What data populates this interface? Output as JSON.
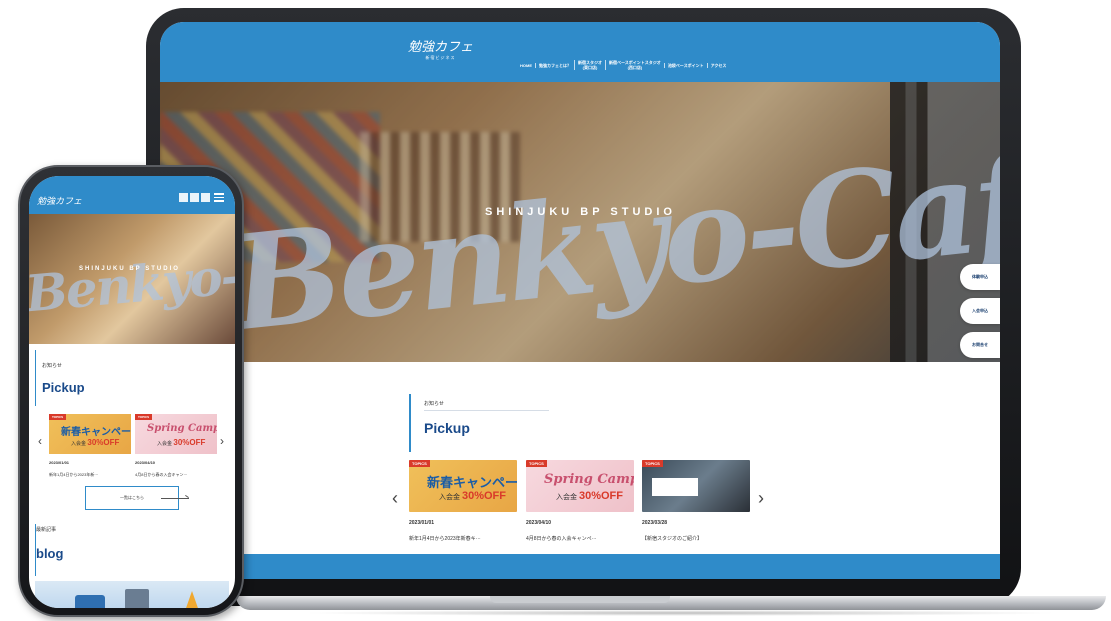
{
  "site": {
    "logo_main": "勉強カフェ",
    "logo_sub": "新宿ビジネス"
  },
  "laptop": {
    "nav": [
      "HOME",
      "勉強カフェとは？",
      "新宿スタジオ\n(東口店)",
      "新宿ベースポイントスタジオ\n(西口店)",
      "池袋ベースポイント",
      "アクセス"
    ],
    "hero": {
      "script_text": "Benkyo-Cafe",
      "title": "SHINJUKU BP STUDIO"
    },
    "side_tabs": [
      "体験申込",
      "入会申込",
      "お問合せ"
    ],
    "news": {
      "label": "お知らせ",
      "heading": "Pickup"
    },
    "cards": [
      {
        "tag": "TOPICS",
        "banner_main": "新春キャンペーン",
        "banner_sub_prefix": "入会金",
        "banner_sub_value": "30%OFF",
        "date": "2023/01/01",
        "title": "新年1月4日から2023年新春キ···"
      },
      {
        "tag": "TOPICS",
        "banner_main": "Spring Campaign",
        "banner_sub_prefix": "入会金",
        "banner_sub_value": "30%OFF",
        "date": "2023/04/10",
        "title": "4月8日から春の入会キャンペ···"
      },
      {
        "tag": "TOPICS",
        "banner_main": "",
        "banner_sub_prefix": "",
        "banner_sub_value": "",
        "date": "2023/03/28",
        "title": "【新宿スタジオのご紹介】"
      }
    ],
    "prev_symbol": "‹",
    "next_symbol": "›"
  },
  "phone": {
    "hero": {
      "script_text": "Benkyo-Cafe",
      "title": "SHINJUKU BP STUDIO"
    },
    "news": {
      "label": "お知らせ",
      "heading": "Pickup"
    },
    "cards": [
      {
        "tag": "TOPICS",
        "banner_main": "新春キャンペーン",
        "banner_sub_prefix": "入会金",
        "banner_sub_value": "30%OFF",
        "date": "2023/01/01",
        "title": "新年1月4日から2023年新···"
      },
      {
        "tag": "TOPICS",
        "banner_main": "Spring Campaign",
        "banner_sub_prefix": "入会金",
        "banner_sub_value": "30%OFF",
        "date": "2023/04/10",
        "title": "4月8日から春の入会キャン···"
      }
    ],
    "more_button": "一覧はこちら",
    "blog": {
      "label": "最新記事",
      "heading": "blog"
    },
    "prev_symbol": "‹",
    "next_symbol": "›"
  },
  "colors": {
    "brand_blue": "#2f8bc9",
    "heading_navy": "#1a4a8a",
    "tag_red": "#d93a2a"
  }
}
